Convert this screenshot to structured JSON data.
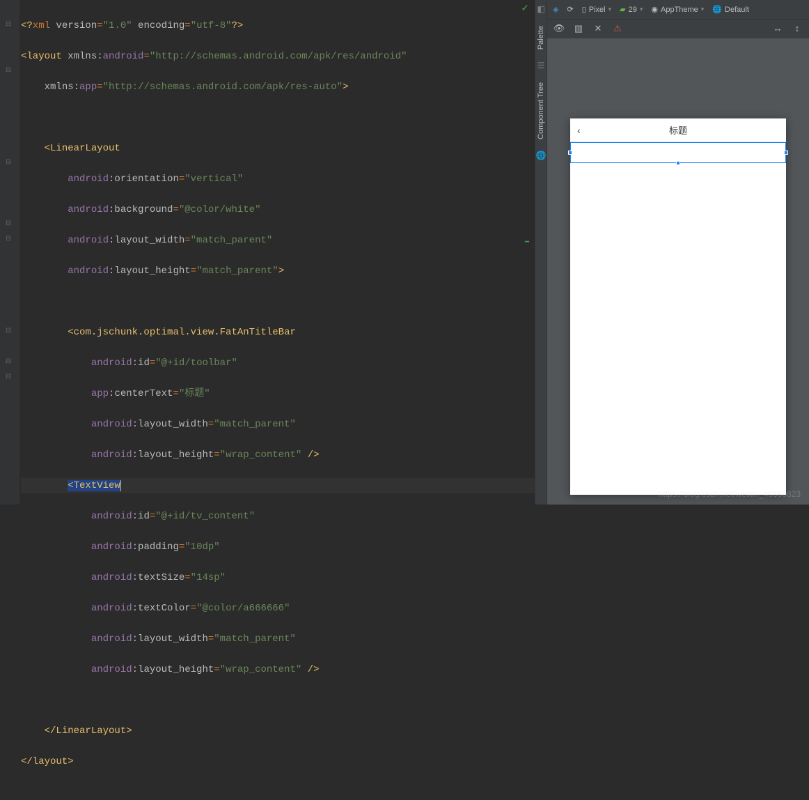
{
  "code": {
    "l1_decl_open": "<?",
    "l1_xml": "xml ",
    "l1_version_attr": "version",
    "l1_version_val": "\"1.0\"",
    "l1_enc_attr": " encoding",
    "l1_enc_val": "\"utf-8\"",
    "l1_decl_close": "?>",
    "l2_tag": "<layout",
    "l2_xmlns": " xmlns:",
    "l2_android": "android",
    "l2_android_val": "\"http://schemas.android.com/apk/res/android\"",
    "l3_xmlns": "xmlns:",
    "l3_app": "app",
    "l3_app_val": "\"http://schemas.android.com/apk/res-auto\"",
    "l3_close": ">",
    "ll_tag": "<LinearLayout",
    "ll_orient_ns": "android",
    "ll_orient_attr": ":orientation",
    "ll_orient_val": "\"vertical\"",
    "ll_bg_attr": ":background",
    "ll_bg_val": "\"@color/white\"",
    "ll_lw_attr": ":layout_width",
    "ll_lw_val": "\"match_parent\"",
    "ll_lh_attr": ":layout_height",
    "ll_lh_val": "\"match_parent\"",
    "ll_close_gt": ">",
    "titlebar_tag": "<com.jschunk.optimal.view.FatAnTitleBar",
    "tb_id_attr": ":id",
    "tb_id_val": "\"@+id/toolbar\"",
    "app_ns": "app",
    "tb_center_attr": ":centerText",
    "tb_center_val": "\"标题\"",
    "tb_lw_val": "\"match_parent\"",
    "tb_lh_val": "\"wrap_content\"",
    "self_close": " />",
    "tv_tag": "<TextView",
    "tv_id_val": "\"@+id/tv_content\"",
    "tv_pad_attr": ":padding",
    "tv_pad_val": "\"10dp\"",
    "tv_ts_attr": ":textSize",
    "tv_ts_val": "\"14sp\"",
    "tv_tc_attr": ":textColor",
    "tv_tc_val": "\"@color/a666666\"",
    "tv_lw_val": "\"match_parent\"",
    "tv_lh_val": "\"wrap_content\"",
    "ll_end": "</LinearLayout>",
    "layout_end": "</layout>"
  },
  "sideTabs": {
    "palette": "Palette",
    "componentTree": "Component Tree"
  },
  "toolbar": {
    "device": "Pixel",
    "api": "29",
    "theme": "AppTheme",
    "locale": "Default"
  },
  "preview": {
    "titleText": "标题",
    "backIcon": "‹"
  },
  "watermark": "https://blog.csdn.net/weixin_46660823"
}
